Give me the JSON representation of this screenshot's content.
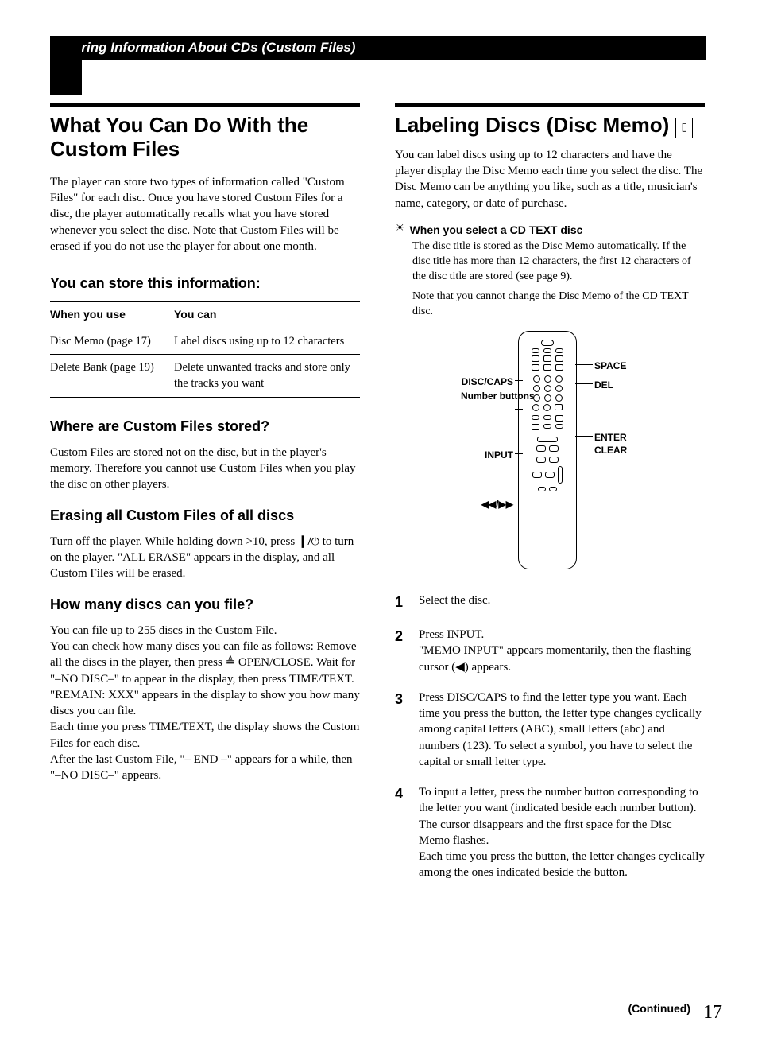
{
  "header": {
    "title": "Storing Information About CDs (Custom Files)"
  },
  "left": {
    "h1": "What You Can Do With the Custom Files",
    "intro": "The player can store two types of information called \"Custom Files\" for each disc. Once you have stored Custom Files for a disc, the player automatically recalls what you have stored whenever you select the disc. Note that Custom Files will be erased if you do not use the player for about one month.",
    "storeHeading": "You can store this information:",
    "table": {
      "th1": "When you use",
      "th2": "You can",
      "rows": [
        {
          "c1": "Disc Memo (page 17)",
          "c2": "Label discs using up to 12 characters"
        },
        {
          "c1": "Delete Bank (page 19)",
          "c2": "Delete unwanted tracks and store only the tracks you want"
        }
      ]
    },
    "whereH": "Where are Custom Files stored?",
    "whereP": "Custom Files are stored not on the disc, but in the player's memory. Therefore you cannot use Custom Files when you play the disc on other players.",
    "eraseH": "Erasing all Custom Files of all discs",
    "eraseP_a": "Turn off the player. While holding down >10, press ",
    "eraseP_b": " to turn on the player. \"ALL ERASE\" appears in the display, and all Custom Files will be erased.",
    "powerPrefix": "❙/",
    "howManyH": "How many discs can you file?",
    "howManyP": "You can file up to 255 discs in the Custom File.\nYou can check how many discs you can file as follows: Remove all the discs in the player, then press ≜ OPEN/CLOSE. Wait for \"–NO DISC–\" to appear in the display, then press TIME/TEXT.\n\"REMAIN: XXX\" appears in the display to show you how many discs you can file.\nEach time you press TIME/TEXT, the display shows the Custom Files for each disc.\nAfter the last Custom File, \"–  END  –\" appears for a while, then \"–NO DISC–\" appears."
  },
  "right": {
    "h1": "Labeling Discs (Disc Memo)",
    "intro": "You can label discs using up to 12 characters and have the player display the Disc Memo each time you select the disc. The Disc Memo can be anything you like, such as a title, musician's name, category, or date of purchase.",
    "tipTitle": "When you select a CD TEXT disc",
    "tipBody1": "The disc title is stored as the Disc Memo automatically. If the disc title has more than 12 characters, the first 12 characters of the disc title are stored (see page 9).",
    "tipBody2": "Note that you cannot change the Disc Memo of the CD TEXT disc.",
    "labels": {
      "space": "SPACE",
      "del": "DEL",
      "discCaps": "DISC/CAPS",
      "numberButtons": "Number buttons",
      "enter": "ENTER",
      "clear": "CLEAR",
      "input": "INPUT",
      "skip": "◀◀/▶▶"
    },
    "steps": [
      {
        "n": "1",
        "body": "Select the disc."
      },
      {
        "n": "2",
        "body": "Press INPUT.\n\"MEMO INPUT\" appears momentarily, then the flashing cursor (◀) appears."
      },
      {
        "n": "3",
        "body": "Press DISC/CAPS to find the letter type you want. Each time you press the button, the letter type changes cyclically among capital letters (ABC), small letters (abc) and numbers (123). To select a symbol, you have to select the capital or small letter type."
      },
      {
        "n": "4",
        "body": "To input a letter, press the number button corresponding to the letter you want (indicated beside each number button).\nThe cursor disappears and the first space for the Disc Memo flashes.\nEach time you press the button, the letter changes cyclically among the ones indicated beside the button."
      }
    ]
  },
  "footer": {
    "continued": "(Continued)",
    "page": "17"
  }
}
